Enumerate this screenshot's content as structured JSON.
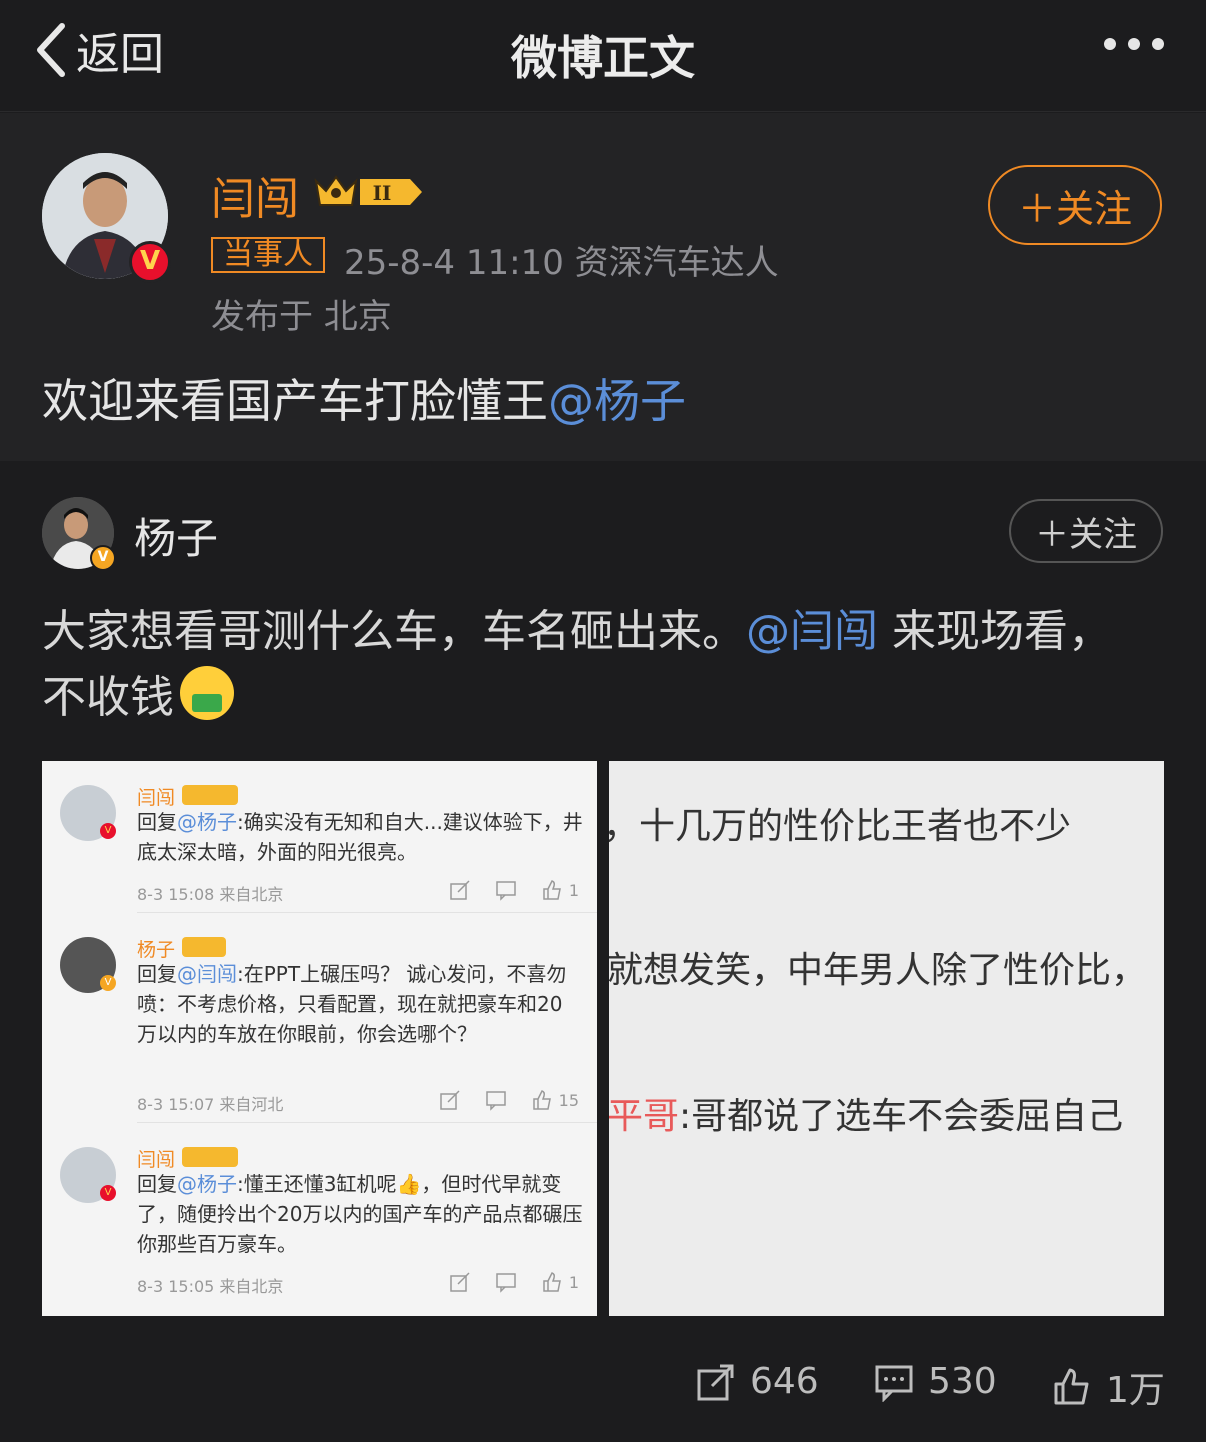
{
  "nav": {
    "back_label": "返回",
    "title": "微博正文"
  },
  "post": {
    "author": "闫闯",
    "follow_label": "＋关注",
    "tag": "当事人",
    "meta": "25-8-4 11:10  资深汽车达人",
    "location": "发布于 北京",
    "text": "欢迎来看国产车打脸懂王",
    "mention": "@杨子"
  },
  "repost": {
    "author": "杨子",
    "follow_label": "＋关注",
    "text_a": "大家想看哥测什么车，车名砸出来。",
    "mention": "@闫闯",
    "text_b": " 来现场看，",
    "text_c": "不收钱",
    "emoji": "book-reading-emoji"
  },
  "image1": {
    "comments": [
      {
        "name": "闫闯",
        "reply_prefix": "回复",
        "reply_to": "@杨子",
        "text": ":确实没有无知和自大...建议体验下，井底太深太暗，外面的阳光很亮。",
        "meta": "8-3 15:08 来自北京",
        "likes": "1"
      },
      {
        "name": "杨子",
        "reply_prefix": "回复",
        "reply_to": "@闫闯",
        "text": ":在PPT上碾压吗？ 诚心发问，不喜勿喷：不考虑价格，只看配置，现在就把豪车和20万以内的车放在你眼前，你会选哪个？",
        "meta": "8-3 15:07 来自河北",
        "likes": "15"
      },
      {
        "name": "闫闯",
        "reply_prefix": "回复",
        "reply_to": "@杨子",
        "text": ":懂王还懂3缸机呢👍，但时代早就变了，随便拎出个20万以内的国产车的产品点都碾压你那些百万豪车。",
        "meta": "8-3 15:05 来自北京",
        "likes": "1"
      }
    ]
  },
  "image2": {
    "line1": "，十几万的性价比王者也不少",
    "line2": "就想发笑，中年男人除了性价比，",
    "line3_red": "平哥",
    "line3": ":哥都说了选车不会委屈自己"
  },
  "actions": {
    "reposts": "646",
    "comments": "530",
    "likes": "1万"
  },
  "colors": {
    "accent": "#f08a24",
    "link": "#5b8ed8",
    "background": "#1c1c1e"
  }
}
